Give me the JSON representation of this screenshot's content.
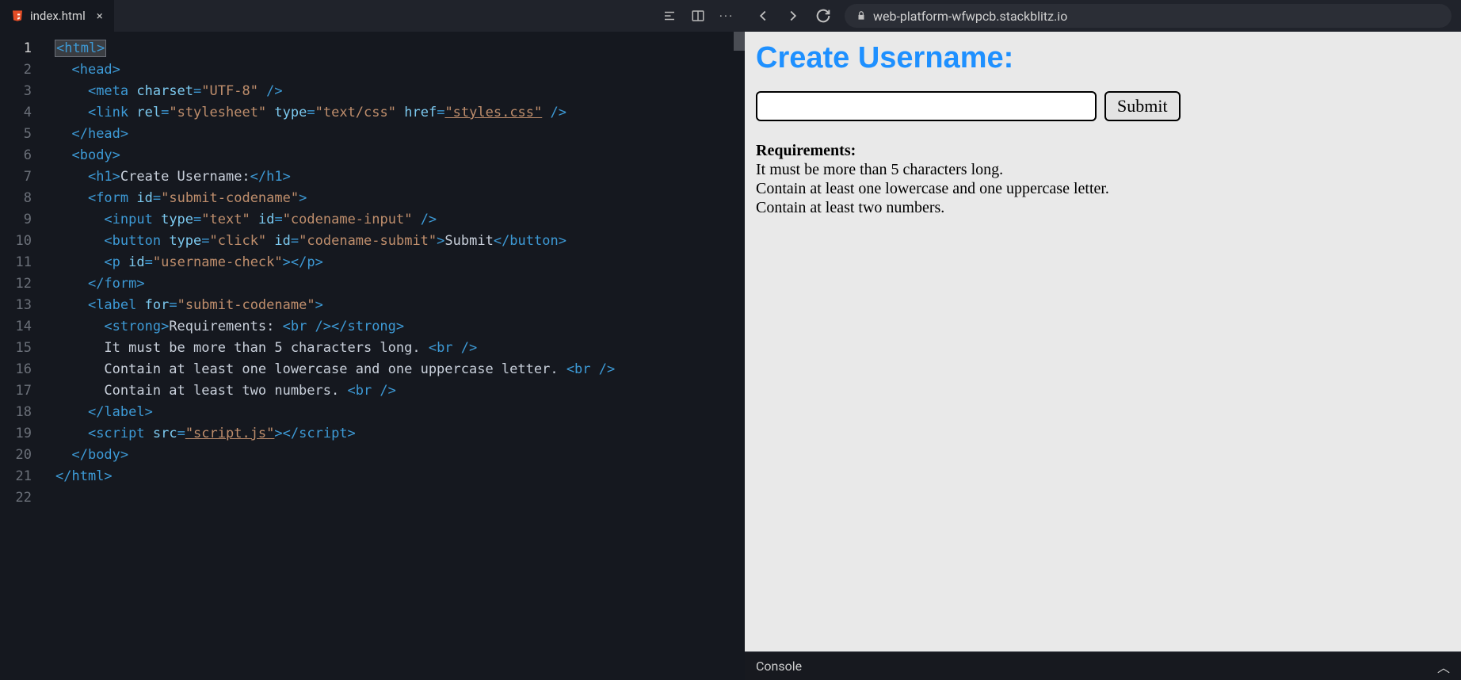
{
  "editor": {
    "tab_filename": "index.html",
    "lines": [
      {
        "n": 1,
        "active": true,
        "segs": [
          {
            "cls": "sel",
            "inner": [
              {
                "cls": "t-tag",
                "t": "<html>"
              }
            ]
          }
        ]
      },
      {
        "n": 2,
        "indent": "  ",
        "segs": [
          {
            "cls": "t-tag",
            "t": "<head>"
          }
        ]
      },
      {
        "n": 3,
        "indent": "    ",
        "segs": [
          {
            "cls": "t-tag",
            "t": "<meta "
          },
          {
            "cls": "t-attr",
            "t": "charset"
          },
          {
            "cls": "t-tag",
            "t": "="
          },
          {
            "cls": "t-str",
            "t": "\"UTF-8\""
          },
          {
            "cls": "t-tag",
            "t": " />"
          }
        ]
      },
      {
        "n": 4,
        "indent": "    ",
        "segs": [
          {
            "cls": "t-tag",
            "t": "<link "
          },
          {
            "cls": "t-attr",
            "t": "rel"
          },
          {
            "cls": "t-tag",
            "t": "="
          },
          {
            "cls": "t-str",
            "t": "\"stylesheet\""
          },
          {
            "cls": "t-tag",
            "t": " "
          },
          {
            "cls": "t-attr",
            "t": "type"
          },
          {
            "cls": "t-tag",
            "t": "="
          },
          {
            "cls": "t-str",
            "t": "\"text/css\""
          },
          {
            "cls": "t-tag",
            "t": " "
          },
          {
            "cls": "t-attr",
            "t": "href"
          },
          {
            "cls": "t-tag",
            "t": "="
          },
          {
            "cls": "t-str t-underline",
            "t": "\"styles.css\""
          },
          {
            "cls": "t-tag",
            "t": " />"
          }
        ]
      },
      {
        "n": 5,
        "indent": "  ",
        "segs": [
          {
            "cls": "t-tag",
            "t": "</head>"
          }
        ]
      },
      {
        "n": 6,
        "indent": "  ",
        "segs": [
          {
            "cls": "t-tag",
            "t": "<body>"
          }
        ]
      },
      {
        "n": 7,
        "indent": "    ",
        "segs": [
          {
            "cls": "t-tag",
            "t": "<h1>"
          },
          {
            "cls": "t-text",
            "t": "Create Username:"
          },
          {
            "cls": "t-tag",
            "t": "</h1>"
          }
        ]
      },
      {
        "n": 8,
        "indent": "    ",
        "segs": [
          {
            "cls": "t-tag",
            "t": "<form "
          },
          {
            "cls": "t-attr",
            "t": "id"
          },
          {
            "cls": "t-tag",
            "t": "="
          },
          {
            "cls": "t-str",
            "t": "\"submit-codename\""
          },
          {
            "cls": "t-tag",
            "t": ">"
          }
        ]
      },
      {
        "n": 9,
        "indent": "      ",
        "segs": [
          {
            "cls": "t-tag",
            "t": "<input "
          },
          {
            "cls": "t-attr",
            "t": "type"
          },
          {
            "cls": "t-tag",
            "t": "="
          },
          {
            "cls": "t-str",
            "t": "\"text\""
          },
          {
            "cls": "t-tag",
            "t": " "
          },
          {
            "cls": "t-attr",
            "t": "id"
          },
          {
            "cls": "t-tag",
            "t": "="
          },
          {
            "cls": "t-str",
            "t": "\"codename-input\""
          },
          {
            "cls": "t-tag",
            "t": " />"
          }
        ]
      },
      {
        "n": 10,
        "indent": "      ",
        "segs": [
          {
            "cls": "t-tag",
            "t": "<button "
          },
          {
            "cls": "t-attr",
            "t": "type"
          },
          {
            "cls": "t-tag",
            "t": "="
          },
          {
            "cls": "t-str",
            "t": "\"click\""
          },
          {
            "cls": "t-tag",
            "t": " "
          },
          {
            "cls": "t-attr",
            "t": "id"
          },
          {
            "cls": "t-tag",
            "t": "="
          },
          {
            "cls": "t-str",
            "t": "\"codename-submit\""
          },
          {
            "cls": "t-tag",
            "t": ">"
          },
          {
            "cls": "t-text",
            "t": "Submit"
          },
          {
            "cls": "t-tag",
            "t": "</button>"
          }
        ]
      },
      {
        "n": 11,
        "indent": "      ",
        "segs": [
          {
            "cls": "t-tag",
            "t": "<p "
          },
          {
            "cls": "t-attr",
            "t": "id"
          },
          {
            "cls": "t-tag",
            "t": "="
          },
          {
            "cls": "t-str",
            "t": "\"username-check\""
          },
          {
            "cls": "t-tag",
            "t": "></p>"
          }
        ]
      },
      {
        "n": 12,
        "indent": "    ",
        "segs": [
          {
            "cls": "t-tag",
            "t": "</form>"
          }
        ]
      },
      {
        "n": 13,
        "indent": "    ",
        "segs": [
          {
            "cls": "t-tag",
            "t": "<label "
          },
          {
            "cls": "t-attr",
            "t": "for"
          },
          {
            "cls": "t-tag",
            "t": "="
          },
          {
            "cls": "t-str",
            "t": "\"submit-codename\""
          },
          {
            "cls": "t-tag",
            "t": ">"
          }
        ]
      },
      {
        "n": 14,
        "indent": "      ",
        "segs": [
          {
            "cls": "t-tag",
            "t": "<strong>"
          },
          {
            "cls": "t-text",
            "t": "Requirements: "
          },
          {
            "cls": "t-tag",
            "t": "<br /></strong>"
          }
        ]
      },
      {
        "n": 15,
        "indent": "      ",
        "segs": [
          {
            "cls": "t-text",
            "t": "It must be more than 5 characters long. "
          },
          {
            "cls": "t-tag",
            "t": "<br />"
          }
        ]
      },
      {
        "n": 16,
        "indent": "      ",
        "segs": [
          {
            "cls": "t-text",
            "t": "Contain at least one lowercase and one uppercase letter. "
          },
          {
            "cls": "t-tag",
            "t": "<br />"
          }
        ]
      },
      {
        "n": 17,
        "indent": "      ",
        "segs": [
          {
            "cls": "t-text",
            "t": "Contain at least two numbers. "
          },
          {
            "cls": "t-tag",
            "t": "<br />"
          }
        ]
      },
      {
        "n": 18,
        "indent": "    ",
        "segs": [
          {
            "cls": "t-tag",
            "t": "</label>"
          }
        ]
      },
      {
        "n": 19,
        "indent": "    ",
        "segs": [
          {
            "cls": "t-tag",
            "t": "<script "
          },
          {
            "cls": "t-attr",
            "t": "src"
          },
          {
            "cls": "t-tag",
            "t": "="
          },
          {
            "cls": "t-str t-underline",
            "t": "\"script.js\""
          },
          {
            "cls": "t-tag",
            "t": "></"
          },
          {
            "cls": "t-tag",
            "t": "script>"
          }
        ]
      },
      {
        "n": 20,
        "indent": "  ",
        "segs": [
          {
            "cls": "t-tag",
            "t": "</body>"
          }
        ]
      },
      {
        "n": 21,
        "indent": "",
        "segs": [
          {
            "cls": "t-tag",
            "t": "</html>"
          }
        ]
      },
      {
        "n": 22,
        "indent": "",
        "segs": []
      }
    ]
  },
  "preview": {
    "url": "web-platform-wfwpcb.stackblitz.io",
    "heading": "Create Username:",
    "submit_label": "Submit",
    "requirements_label": "Requirements:",
    "req_lines": [
      "It must be more than 5 characters long.",
      "Contain at least one lowercase and one uppercase letter.",
      "Contain at least two numbers."
    ],
    "console_label": "Console"
  }
}
